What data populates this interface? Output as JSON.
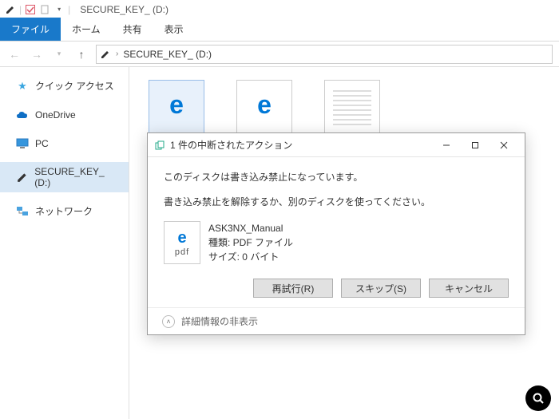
{
  "window": {
    "title": "SECURE_KEY_ (D:)"
  },
  "ribbon": {
    "file": "ファイル",
    "home": "ホーム",
    "share": "共有",
    "view": "表示"
  },
  "path": {
    "current": "SECURE_KEY_ (D:)"
  },
  "sidebar": {
    "quick": "クイック アクセス",
    "onedrive": "OneDrive",
    "pc": "PC",
    "secure": "SECURE_KEY_ (D:)",
    "network": "ネットワーク"
  },
  "dialog": {
    "title": "1 件の中断されたアクション",
    "msg1": "このディスクは書き込み禁止になっています。",
    "msg2": "書き込み禁止を解除するか、別のディスクを使ってください。",
    "file": {
      "name": "ASK3NX_Manual",
      "type_label": "種類: PDF ファイル",
      "size_label": "サイズ: 0 バイト"
    },
    "retry": "再試行(R)",
    "skip": "スキップ(S)",
    "cancel": "キャンセル",
    "details": "詳細情報の非表示"
  },
  "icons": {
    "pdf_label": "pdf"
  }
}
